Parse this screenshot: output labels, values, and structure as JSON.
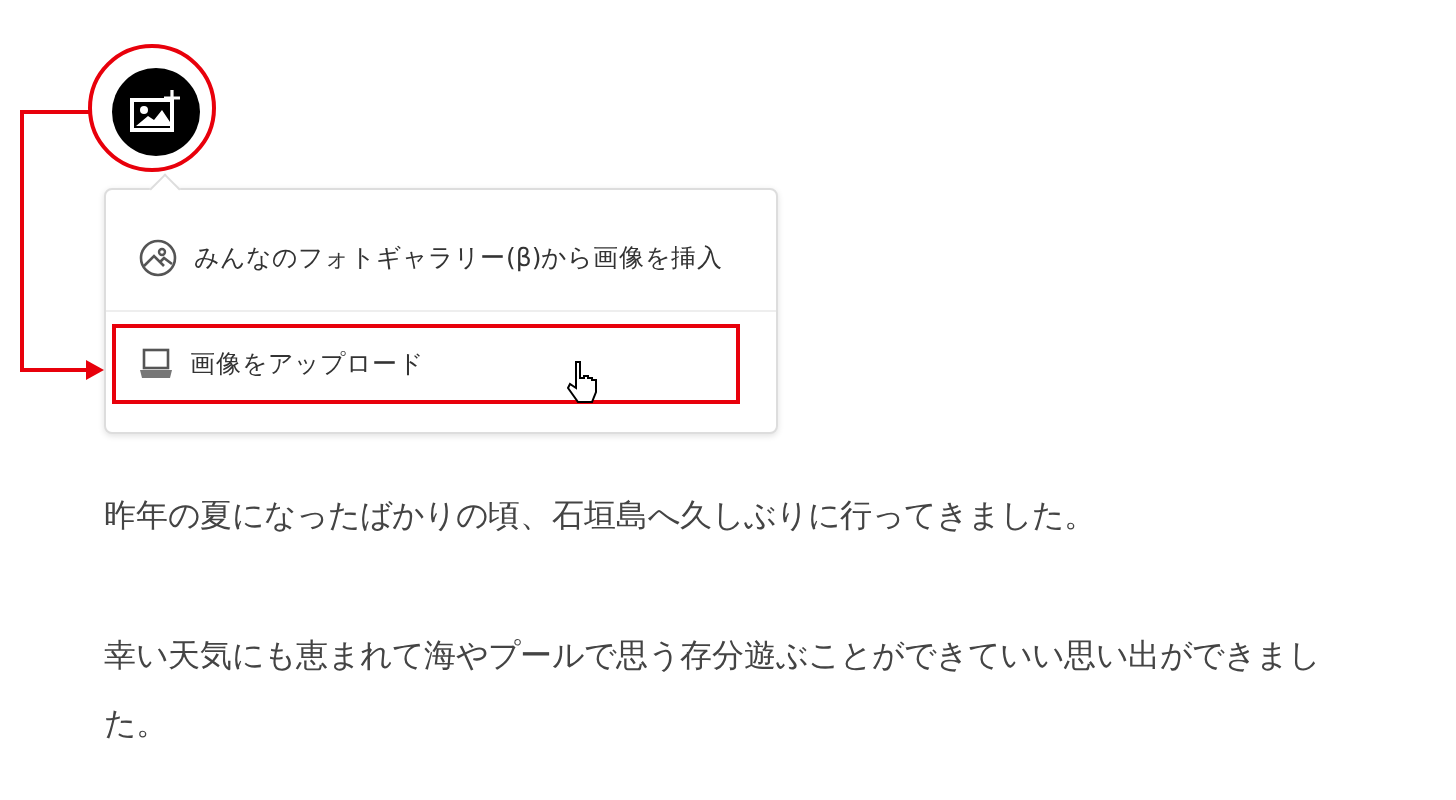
{
  "insert_image_button": {
    "highlighted": true
  },
  "menu": {
    "items": [
      {
        "kind": "gallery",
        "label": "みんなのフォトギャラリー(β)から画像を挿入",
        "selected": false
      },
      {
        "kind": "upload",
        "label": "画像をアップロード",
        "selected": true
      }
    ]
  },
  "paragraphs": [
    "昨年の夏になったばかりの頃、石垣島へ久しぶりに行ってきました。",
    "幸い天気にも恵まれて海やプールで思う存分遊ぶことができていい思い出ができました。"
  ]
}
